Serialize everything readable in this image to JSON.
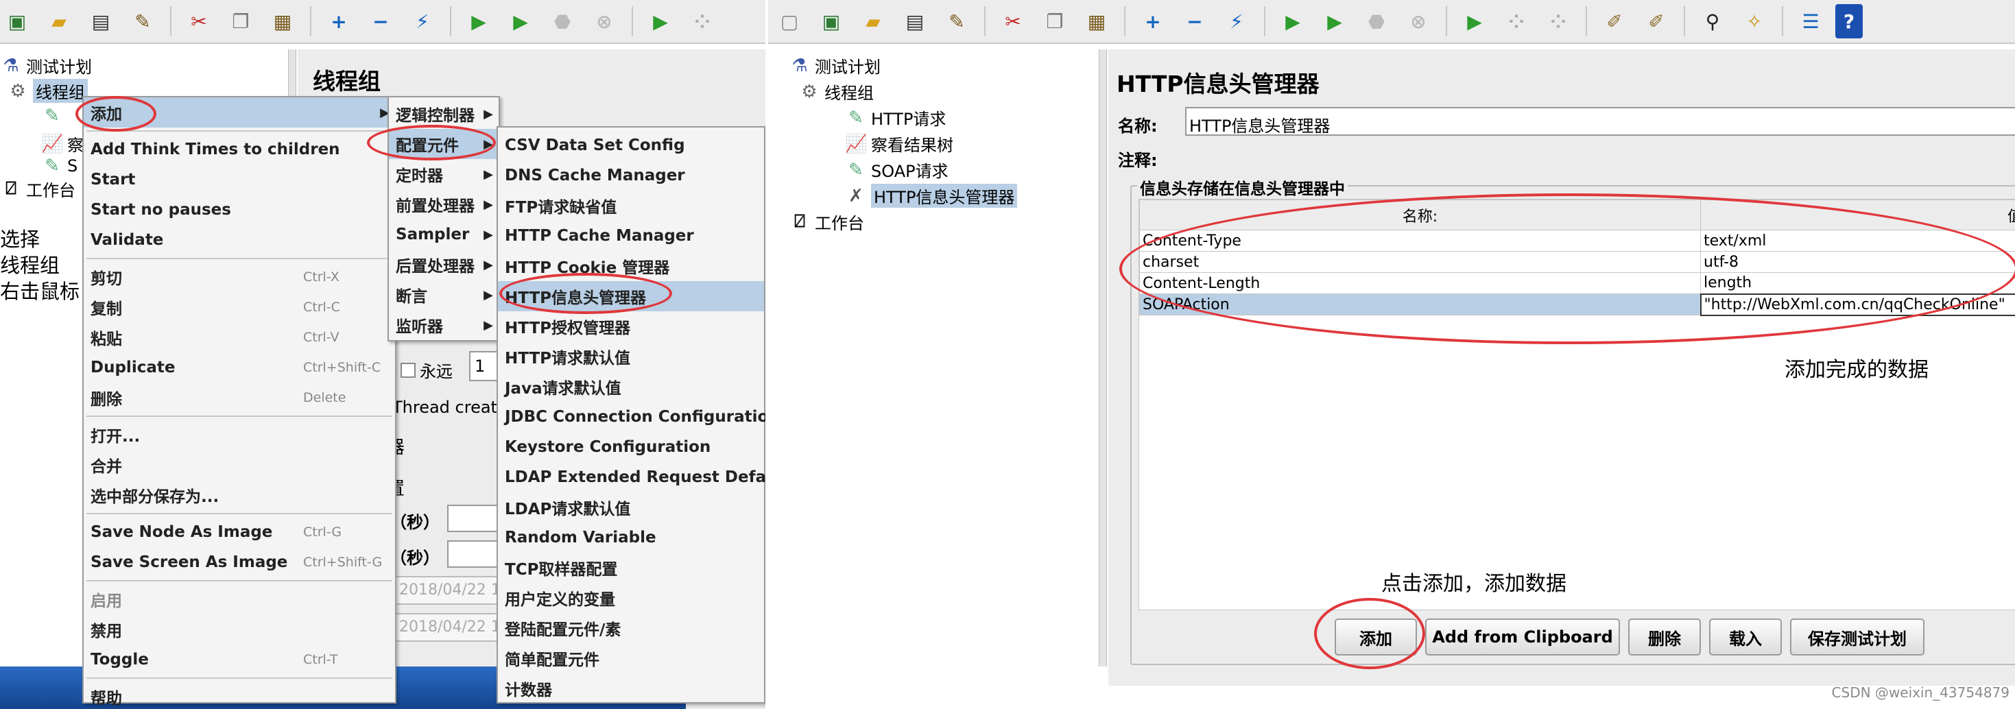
{
  "left": {
    "tree": {
      "test_plan": "测试计划",
      "thread_group": "线程组",
      "item_a": "察",
      "item_b": "S",
      "workbench": "工作台"
    },
    "panel_title": "线程组",
    "annotation": [
      "选择",
      "线程组",
      "右击鼠标"
    ],
    "bg": {
      "forever": "永远",
      "loop_value": "1",
      "thread_creation": "Thread creatio",
      "section_char": "器",
      "section_char2": "置",
      "seconds1": "（秒）",
      "seconds2": "（秒）",
      "date1": "2018/04/22 1",
      "date2": "2018/04/22 1"
    },
    "context_menu": [
      {
        "label": "添加",
        "arrow": "▶",
        "highlight": true
      },
      {
        "label": "Add Think Times to children"
      },
      {
        "label": "Start"
      },
      {
        "label": "Start no pauses"
      },
      {
        "label": "Validate"
      },
      {
        "label": "剪切",
        "shortcut": "Ctrl-X"
      },
      {
        "label": "复制",
        "shortcut": "Ctrl-C"
      },
      {
        "label": "粘贴",
        "shortcut": "Ctrl-V"
      },
      {
        "label": "Duplicate",
        "shortcut": "Ctrl+Shift-C"
      },
      {
        "label": "删除",
        "shortcut": "Delete"
      },
      {
        "label": "打开..."
      },
      {
        "label": "合并"
      },
      {
        "label": "选中部分保存为..."
      },
      {
        "label": "Save Node As Image",
        "shortcut": "Ctrl-G"
      },
      {
        "label": "Save Screen As Image",
        "shortcut": "Ctrl+Shift-G"
      },
      {
        "label": "启用",
        "disabled": true
      },
      {
        "label": "禁用"
      },
      {
        "label": "Toggle",
        "shortcut": "Ctrl-T"
      },
      {
        "label": "帮助"
      }
    ],
    "submenu": [
      {
        "label": "逻辑控制器",
        "arrow": "▶"
      },
      {
        "label": "配置元件",
        "arrow": "▶",
        "highlight": true
      },
      {
        "label": "定时器",
        "arrow": "▶"
      },
      {
        "label": "前置处理器",
        "arrow": "▶"
      },
      {
        "label": "Sampler",
        "arrow": "▶"
      },
      {
        "label": "后置处理器",
        "arrow": "▶"
      },
      {
        "label": "断言",
        "arrow": "▶"
      },
      {
        "label": "监听器",
        "arrow": "▶"
      }
    ],
    "config_menu": [
      {
        "label": "CSV Data Set Config"
      },
      {
        "label": "DNS Cache Manager"
      },
      {
        "label": "FTP请求缺省值"
      },
      {
        "label": "HTTP Cache Manager"
      },
      {
        "label": "HTTP Cookie 管理器"
      },
      {
        "label": "HTTP信息头管理器",
        "highlight": true
      },
      {
        "label": "HTTP授权管理器"
      },
      {
        "label": "HTTP请求默认值"
      },
      {
        "label": "Java请求默认值"
      },
      {
        "label": "JDBC Connection Configuration"
      },
      {
        "label": "Keystore Configuration"
      },
      {
        "label": "LDAP Extended Request Defaults"
      },
      {
        "label": "LDAP请求默认值"
      },
      {
        "label": "Random Variable"
      },
      {
        "label": "TCP取样器配置"
      },
      {
        "label": "用户定义的变量"
      },
      {
        "label": "登陆配置元件/素"
      },
      {
        "label": "简单配置元件"
      },
      {
        "label": "计数器"
      }
    ]
  },
  "right": {
    "tree": {
      "test_plan": "测试计划",
      "thread_group": "线程组",
      "http_request": "HTTP请求",
      "results_tree": "察看结果树",
      "soap_request": "SOAP请求",
      "header_manager": "HTTP信息头管理器",
      "workbench": "工作台"
    },
    "panel_title": "HTTP信息头管理器",
    "name_label": "名称:",
    "name_value": "HTTP信息头管理器",
    "comment_label": "注释:",
    "group_title": "信息头存储在信息头管理器中",
    "col_name": "名称:",
    "col_value": "值",
    "rows": [
      {
        "name": "Content-Type",
        "value": "text/xml"
      },
      {
        "name": "charset",
        "value": "utf-8"
      },
      {
        "name": "Content-Length",
        "value": "length"
      },
      {
        "name": "SOAPAction",
        "value": "\"http://WebXml.com.cn/qqCheckOnline\""
      }
    ],
    "note_data": "添加完成的数据",
    "note_add": "点击添加，添加数据",
    "buttons": {
      "add": "添加",
      "clipboard": "Add from Clipboard",
      "delete": "删除",
      "load": "载入",
      "save": "保存测试计划"
    }
  },
  "watermark": "CSDN @weixin_43754879",
  "colors": {
    "annotation_red": "#e0373b",
    "selection_blue": "#b8cfe5",
    "menu_bg": "#f4f4f4"
  }
}
